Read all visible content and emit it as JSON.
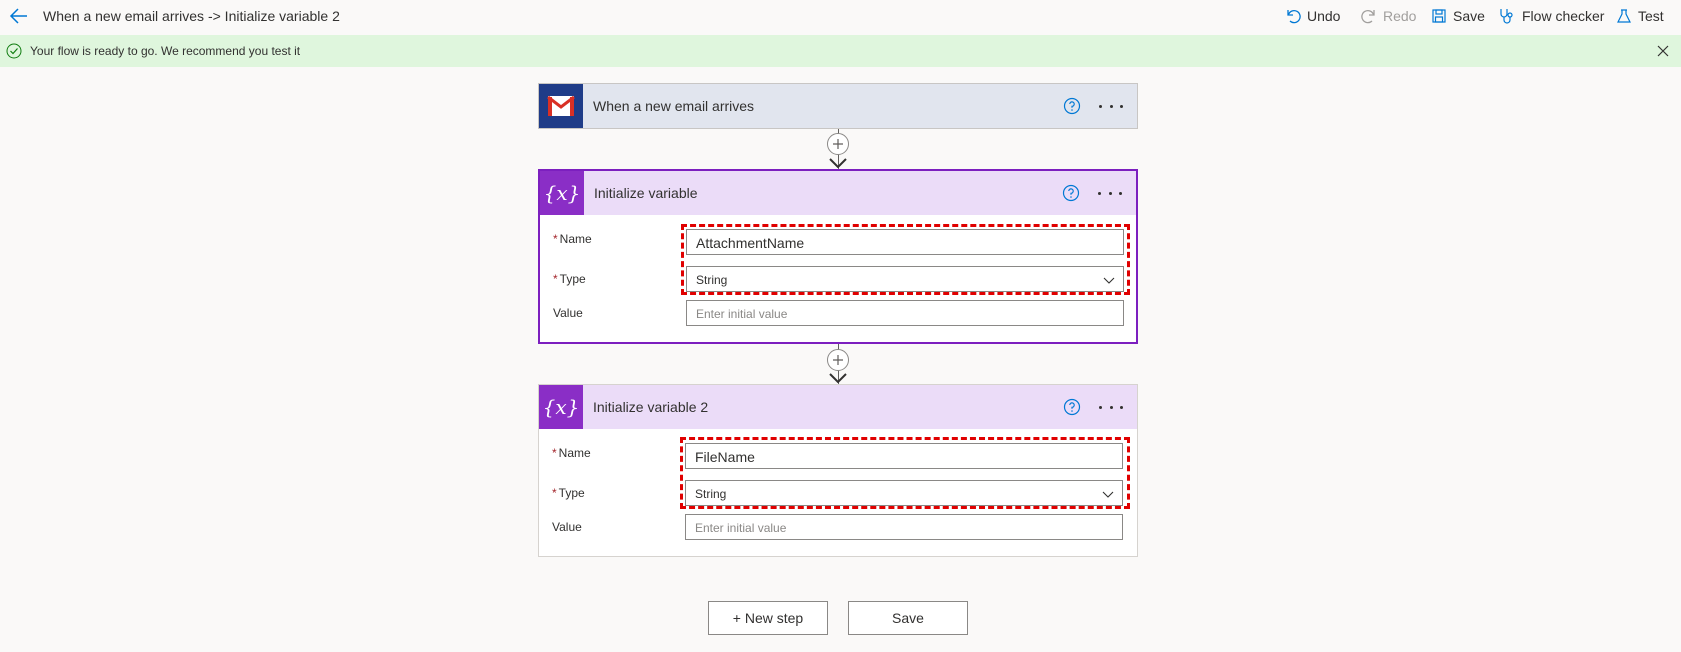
{
  "header": {
    "title": "When a new email arrives -> Initialize variable 2",
    "commands": {
      "undo": "Undo",
      "redo": "Redo",
      "save": "Save",
      "flow_checker": "Flow checker",
      "test": "Test"
    }
  },
  "banner": {
    "message": "Your flow is ready to go. We recommend you test it"
  },
  "trigger": {
    "title": "When a new email arrives"
  },
  "steps": [
    {
      "title": "Initialize variable",
      "icon_glyph": "{x}",
      "name_label": "Name",
      "name_value": "AttachmentName",
      "type_label": "Type",
      "type_value": "String",
      "value_label": "Value",
      "value_placeholder": "Enter initial value"
    },
    {
      "title": "Initialize variable 2",
      "icon_glyph": "{x}",
      "name_label": "Name",
      "name_value": "FileName",
      "type_label": "Type",
      "type_value": "String",
      "value_label": "Value",
      "value_placeholder": "Enter initial value"
    }
  ],
  "footer": {
    "new_step_label": "+ New step",
    "save_label": "Save"
  },
  "colors": {
    "banner_bg": "#dff6dd",
    "variable_accent": "#8a2ec6",
    "selected_border": "#7c1fbf",
    "highlight": "#e00000",
    "link_blue": "#0078d4"
  },
  "icons": {
    "back": "arrow-left-icon",
    "undo": "undo-icon",
    "redo": "redo-icon",
    "save": "save-icon",
    "flow_checker": "stethoscope-icon",
    "test": "flask-icon",
    "banner": "check-circle-icon",
    "close": "close-icon",
    "trigger": "gmail-icon",
    "help": "help-circle-icon",
    "more": "more-icon",
    "add": "plus-icon"
  }
}
